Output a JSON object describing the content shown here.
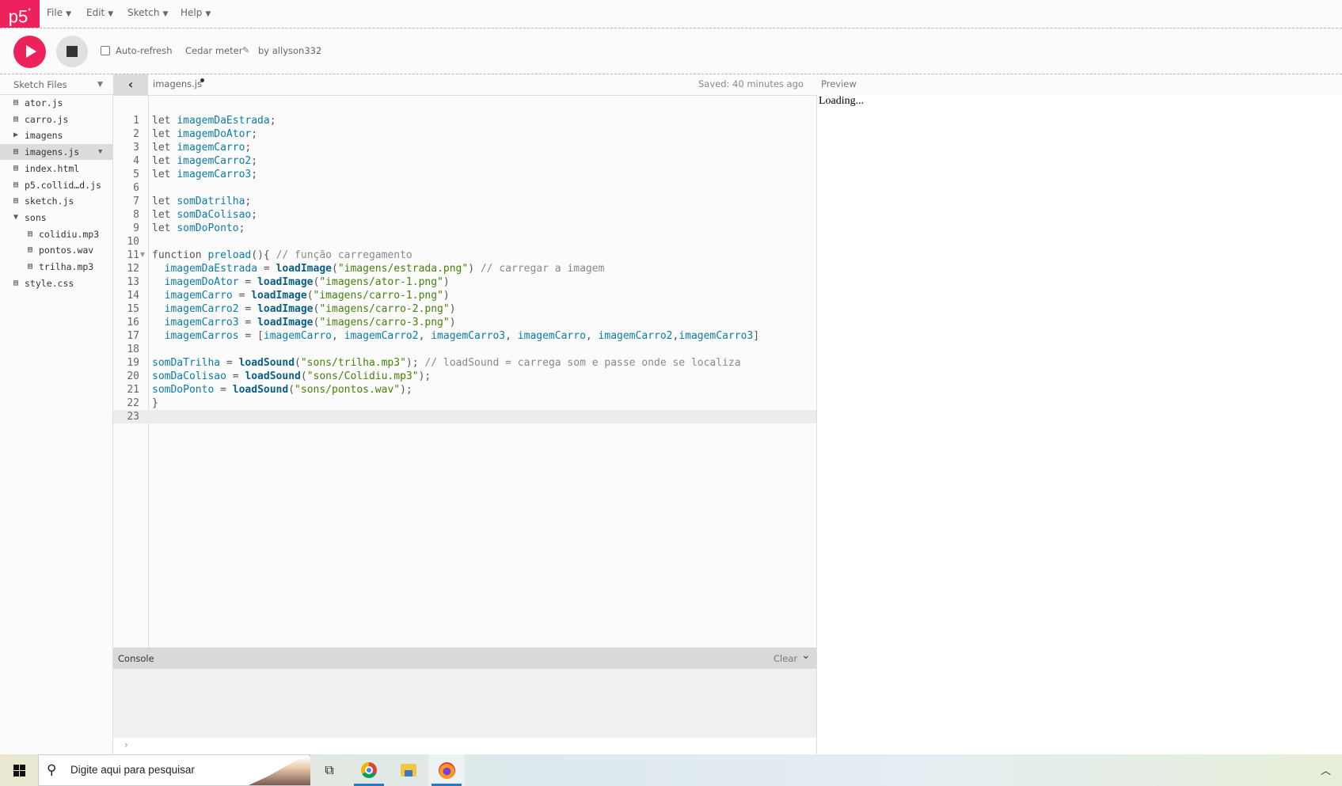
{
  "app": {
    "logo": "p5",
    "logo_mark": "*",
    "brand_color": "#ed225d"
  },
  "menu": [
    {
      "label": "File"
    },
    {
      "label": "Edit"
    },
    {
      "label": "Sketch"
    },
    {
      "label": "Help"
    }
  ],
  "toolbar": {
    "auto_refresh_label": "Auto-refresh",
    "auto_refresh_checked": false,
    "sketch_name": "Cedar meter",
    "author": "by allyson332"
  },
  "sidebar": {
    "title": "Sketch Files",
    "files": [
      {
        "name": "ator.js",
        "type": "file",
        "depth": 0
      },
      {
        "name": "carro.js",
        "type": "file",
        "depth": 0
      },
      {
        "name": "imagens",
        "type": "folder-collapsed",
        "depth": 0
      },
      {
        "name": "imagens.js",
        "type": "file",
        "depth": 0,
        "selected": true
      },
      {
        "name": "index.html",
        "type": "file",
        "depth": 0
      },
      {
        "name": "p5.collid…d.js",
        "type": "file",
        "depth": 0
      },
      {
        "name": "sketch.js",
        "type": "file",
        "depth": 0
      },
      {
        "name": "sons",
        "type": "folder-expanded",
        "depth": 0
      },
      {
        "name": "colidiu.mp3",
        "type": "file",
        "depth": 1
      },
      {
        "name": "pontos.wav",
        "type": "file",
        "depth": 1
      },
      {
        "name": "trilha.mp3",
        "type": "file",
        "depth": 1
      },
      {
        "name": "style.css",
        "type": "file",
        "depth": 0
      }
    ]
  },
  "editor": {
    "file_name": "imagens.js",
    "unsaved": true,
    "saved_status": "Saved: 40 minutes ago",
    "active_line": 23,
    "lines": [
      [
        [
          "kw",
          "let "
        ],
        [
          "var",
          "imagemDaEstrada"
        ],
        [
          "op",
          ";"
        ]
      ],
      [
        [
          "kw",
          "let "
        ],
        [
          "var",
          "imagemDoAtor"
        ],
        [
          "op",
          ";"
        ]
      ],
      [
        [
          "kw",
          "let "
        ],
        [
          "var",
          "imagemCarro"
        ],
        [
          "op",
          ";"
        ]
      ],
      [
        [
          "kw",
          "let "
        ],
        [
          "var",
          "imagemCarro2"
        ],
        [
          "op",
          ";"
        ]
      ],
      [
        [
          "kw",
          "let "
        ],
        [
          "var",
          "imagemCarro3"
        ],
        [
          "op",
          ";"
        ]
      ],
      [],
      [
        [
          "kw",
          "let "
        ],
        [
          "var",
          "somDatrilha"
        ],
        [
          "op",
          ";"
        ]
      ],
      [
        [
          "kw",
          "let "
        ],
        [
          "var",
          "somDaColisao"
        ],
        [
          "op",
          ";"
        ]
      ],
      [
        [
          "kw",
          "let "
        ],
        [
          "var",
          "somDoPonto"
        ],
        [
          "op",
          ";"
        ]
      ],
      [],
      [
        [
          "kw",
          "function "
        ],
        [
          "var",
          "preload"
        ],
        [
          "op",
          "(){ "
        ],
        [
          "cm",
          "// função carregamento"
        ]
      ],
      [
        [
          "op",
          "  "
        ],
        [
          "var",
          "imagemDaEstrada"
        ],
        [
          "op",
          " = "
        ],
        [
          "fn",
          "loadImage"
        ],
        [
          "op",
          "("
        ],
        [
          "str",
          "\"imagens/estrada.png\""
        ],
        [
          "op",
          ") "
        ],
        [
          "cm",
          "// carregar a imagem"
        ]
      ],
      [
        [
          "op",
          "  "
        ],
        [
          "var",
          "imagemDoAtor"
        ],
        [
          "op",
          " = "
        ],
        [
          "fn",
          "loadImage"
        ],
        [
          "op",
          "("
        ],
        [
          "str",
          "\"imagens/ator-1.png\""
        ],
        [
          "op",
          ")"
        ]
      ],
      [
        [
          "op",
          "  "
        ],
        [
          "var",
          "imagemCarro"
        ],
        [
          "op",
          " = "
        ],
        [
          "fn",
          "loadImage"
        ],
        [
          "op",
          "("
        ],
        [
          "str",
          "\"imagens/carro-1.png\""
        ],
        [
          "op",
          ")"
        ]
      ],
      [
        [
          "op",
          "  "
        ],
        [
          "var",
          "imagemCarro2"
        ],
        [
          "op",
          " = "
        ],
        [
          "fn",
          "loadImage"
        ],
        [
          "op",
          "("
        ],
        [
          "str",
          "\"imagens/carro-2.png\""
        ],
        [
          "op",
          ")"
        ]
      ],
      [
        [
          "op",
          "  "
        ],
        [
          "var",
          "imagemCarro3"
        ],
        [
          "op",
          " = "
        ],
        [
          "fn",
          "loadImage"
        ],
        [
          "op",
          "("
        ],
        [
          "str",
          "\"imagens/carro-3.png\""
        ],
        [
          "op",
          ")"
        ]
      ],
      [
        [
          "op",
          "  "
        ],
        [
          "var",
          "imagemCarros"
        ],
        [
          "op",
          " = ["
        ],
        [
          "var",
          "imagemCarro"
        ],
        [
          "op",
          ", "
        ],
        [
          "var",
          "imagemCarro2"
        ],
        [
          "op",
          ", "
        ],
        [
          "var",
          "imagemCarro3"
        ],
        [
          "op",
          ", "
        ],
        [
          "var",
          "imagemCarro"
        ],
        [
          "op",
          ", "
        ],
        [
          "var",
          "imagemCarro2"
        ],
        [
          "op",
          ","
        ],
        [
          "var",
          "imagemCarro3"
        ],
        [
          "op",
          "]"
        ]
      ],
      [],
      [
        [
          "var",
          "somDaTrilha"
        ],
        [
          "op",
          " = "
        ],
        [
          "fn",
          "loadSound"
        ],
        [
          "op",
          "("
        ],
        [
          "str",
          "\"sons/trilha.mp3\""
        ],
        [
          "op",
          "); "
        ],
        [
          "cm",
          "// loadSound = carrega som e passe onde se localiza"
        ]
      ],
      [
        [
          "var",
          "somDaColisao"
        ],
        [
          "op",
          " = "
        ],
        [
          "fn",
          "loadSound"
        ],
        [
          "op",
          "("
        ],
        [
          "str",
          "\"sons/Colidiu.mp3\""
        ],
        [
          "op",
          ");"
        ]
      ],
      [
        [
          "var",
          "somDoPonto"
        ],
        [
          "op",
          " = "
        ],
        [
          "fn",
          "loadSound"
        ],
        [
          "op",
          "("
        ],
        [
          "str",
          "\"sons/pontos.wav\""
        ],
        [
          "op",
          ");"
        ]
      ],
      [
        [
          "op",
          "}"
        ]
      ],
      []
    ],
    "fold_lines": [
      11
    ]
  },
  "console": {
    "title": "Console",
    "clear_label": "Clear",
    "prompt": "›"
  },
  "preview": {
    "label": "Preview",
    "content": "Loading..."
  },
  "taskbar": {
    "search_placeholder": "Digite aqui para pesquisar",
    "apps": [
      "task-view",
      "chrome",
      "file-explorer",
      "firefox"
    ],
    "active_app": "firefox"
  }
}
